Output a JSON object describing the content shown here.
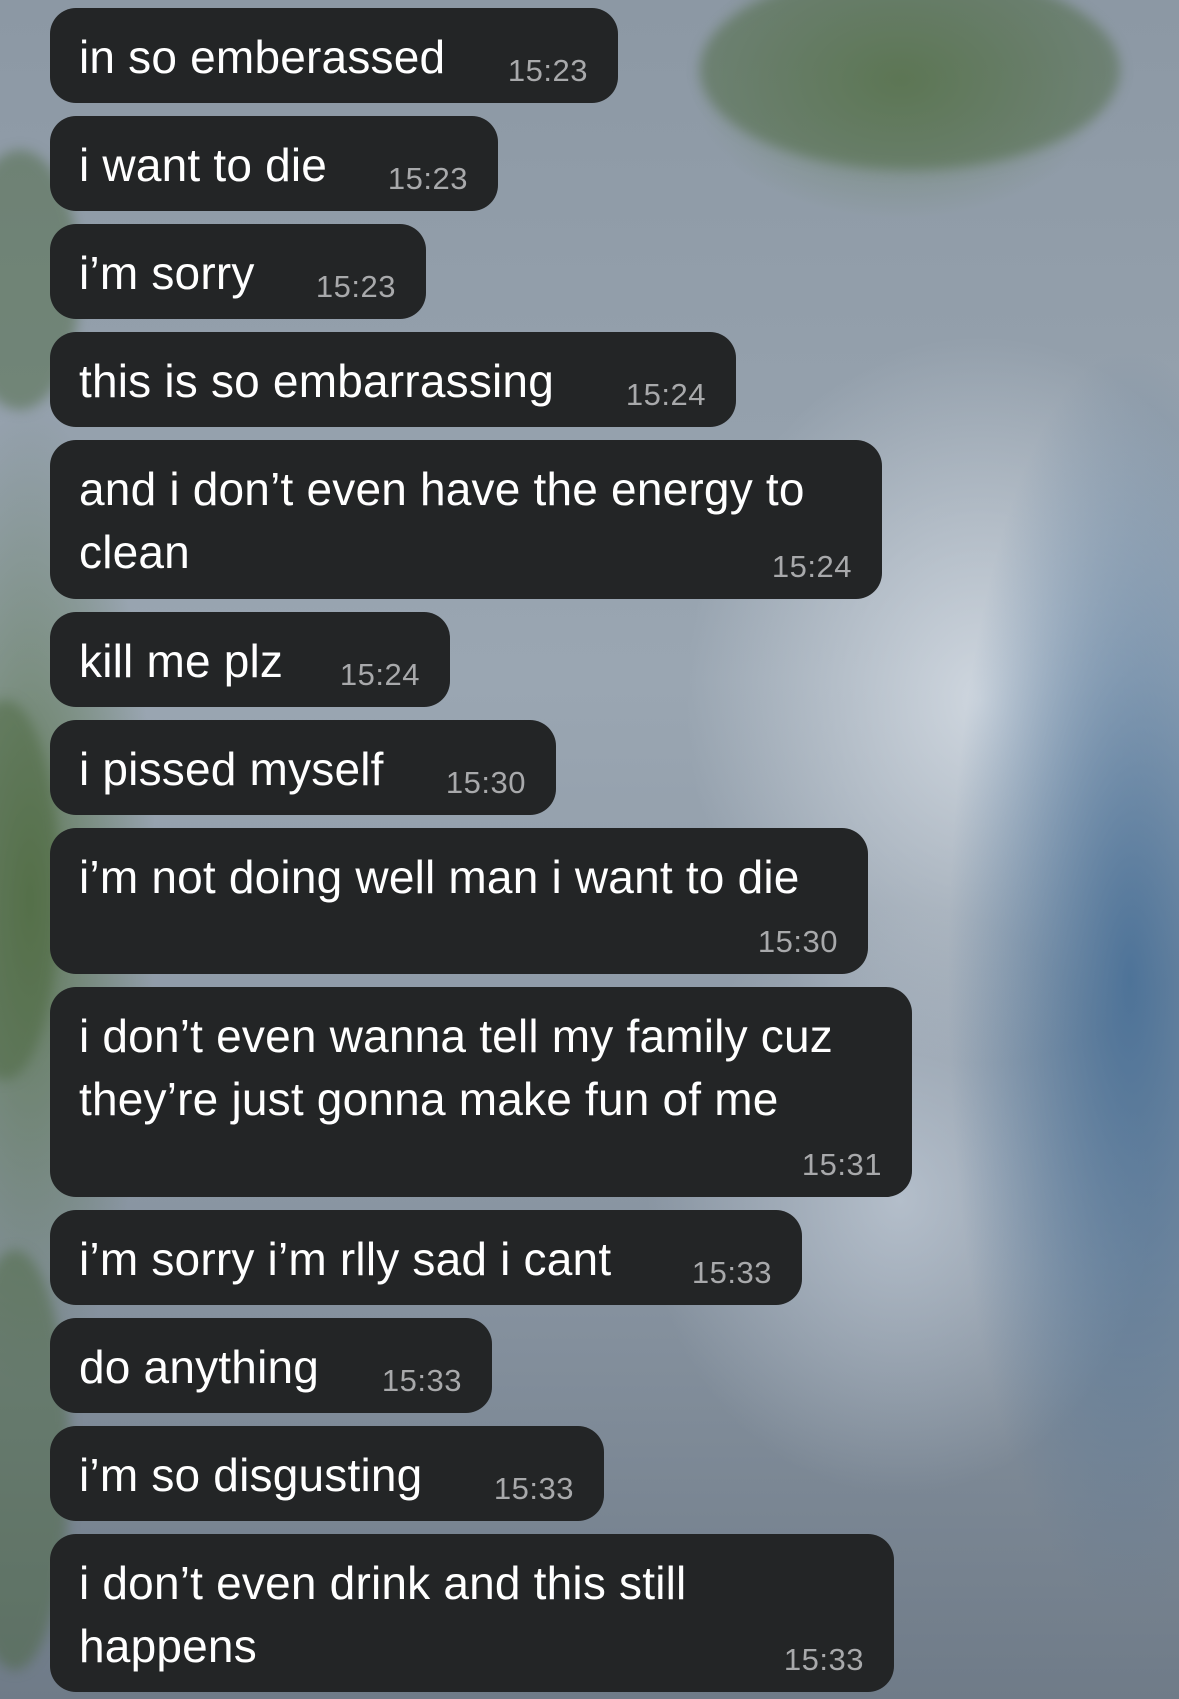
{
  "messages": [
    {
      "lines": [
        "in so emberassed"
      ],
      "time": "15:23"
    },
    {
      "lines": [
        "i want to die"
      ],
      "time": "15:23"
    },
    {
      "lines": [
        "i’m sorry"
      ],
      "time": "15:23"
    },
    {
      "lines": [
        "this is so embarrassing"
      ],
      "time": "15:24"
    },
    {
      "lines": [
        "and i don’t even have the energy to",
        "clean"
      ],
      "time": "15:24"
    },
    {
      "lines": [
        "kill me plz"
      ],
      "time": "15:24"
    },
    {
      "lines": [
        "i pissed myself"
      ],
      "time": "15:30"
    },
    {
      "lines": [
        "i’m not doing well man i want to die"
      ],
      "time": "15:30"
    },
    {
      "lines": [
        "i don’t even wanna tell my family cuz",
        "they’re just gonna make fun of me"
      ],
      "time": "15:31"
    },
    {
      "lines": [
        "i’m sorry i’m rlly sad i cant"
      ],
      "time": "15:33"
    },
    {
      "lines": [
        "do anything"
      ],
      "time": "15:33"
    },
    {
      "lines": [
        "i’m so disgusting"
      ],
      "time": "15:33"
    },
    {
      "lines": [
        "i don’t even drink and this still",
        "happens"
      ],
      "time": "15:33"
    }
  ]
}
